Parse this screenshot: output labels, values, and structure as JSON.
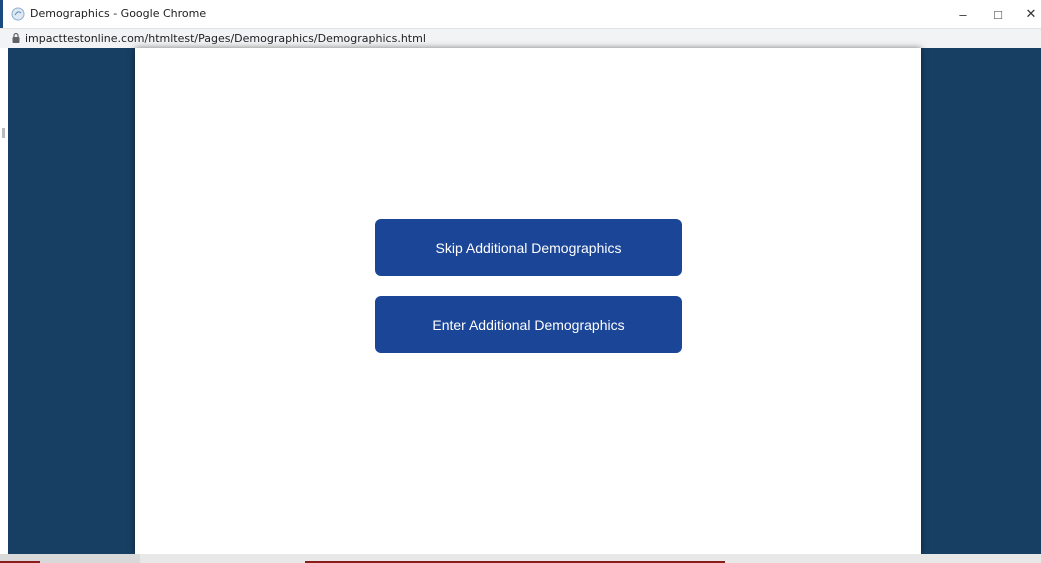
{
  "window": {
    "title": "Demographics - Google Chrome",
    "app_icon": "chrome-page-icon",
    "controls": {
      "minimize_icon": "minimize-icon",
      "maximize_icon": "maximize-icon",
      "close_icon": "close-icon",
      "minimize_glyph": "–",
      "maximize_glyph": "□",
      "close_glyph": "✕"
    }
  },
  "address_bar": {
    "lock_icon": "lock-icon",
    "url": "impacttestonline.com/htmltest/Pages/Demographics/Demographics.html"
  },
  "page": {
    "skip_button_label": "Skip Additional Demographics",
    "enter_button_label": "Enter Additional Demographics"
  },
  "colors": {
    "outer_background": "#173f64",
    "button_background": "#1b4597",
    "button_text": "#ffffff",
    "page_background": "#ffffff"
  }
}
